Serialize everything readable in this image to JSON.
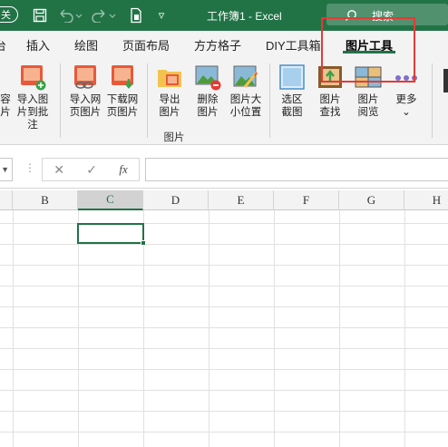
{
  "titlebar": {
    "autosave_label": "关",
    "doc_title": "工作簿1  -  Excel",
    "search_placeholder": "搜索",
    "more_icon": "▿"
  },
  "tabs": [
    {
      "label": "插入"
    },
    {
      "label": "绘图"
    },
    {
      "label": "页面布局"
    },
    {
      "label": "方方格子"
    },
    {
      "label": "DIY工具箱"
    },
    {
      "label": "图片工具",
      "active": true
    }
  ],
  "partial_tab": "台",
  "ribbon": {
    "buttons": [
      {
        "label": "容\n片",
        "icon": "partial-icon"
      },
      {
        "label": "导入图\n片到批注",
        "icon": "import-to-comment-icon"
      },
      {
        "label": "导入网\n页图片",
        "icon": "import-web-image-icon"
      },
      {
        "label": "下载网\n页图片",
        "icon": "download-web-image-icon"
      },
      {
        "label": "导出\n图片",
        "icon": "export-image-icon"
      },
      {
        "label": "删除\n图片",
        "icon": "delete-image-icon"
      },
      {
        "label": "图片大\n小位置",
        "icon": "image-size-position-icon"
      },
      {
        "label": "选区\n截图",
        "icon": "selection-screenshot-icon"
      },
      {
        "label": "图片\n查找",
        "icon": "image-find-icon"
      },
      {
        "label": "图片\n阅览",
        "icon": "image-preview-icon"
      },
      {
        "label": "更多\n⌄",
        "icon": "more-dots-icon"
      }
    ],
    "group_label": "图片"
  },
  "formula_bar": {
    "cancel": "✕",
    "confirm": "✓",
    "fx": "fx",
    "value": ""
  },
  "columns": [
    "B",
    "C",
    "D",
    "E",
    "F",
    "G",
    "H"
  ],
  "selected_column": "C",
  "colors": {
    "excel_green": "#217346",
    "highlight_red": "#e53935"
  }
}
